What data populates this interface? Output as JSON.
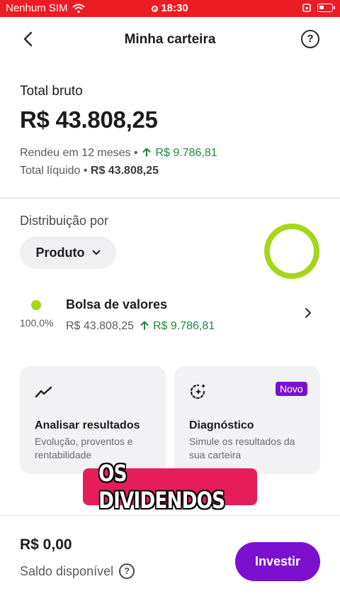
{
  "status_bar": {
    "carrier": "Nenhum SIM",
    "time": "18:30"
  },
  "header": {
    "title": "Minha carteira",
    "help": "?"
  },
  "summary": {
    "total_label": "Total bruto",
    "total_value": "R$ 43.808,25",
    "earned_label": "Rendeu em 12 meses",
    "earned_value": "R$ 9.786,81",
    "net_label": "Total líquido",
    "net_value": "R$ 43.808,25",
    "separator": "•"
  },
  "distribution": {
    "label": "Distribuição por",
    "filter": "Produto",
    "chart_color": "#a6d61a",
    "assets": [
      {
        "name": "Bolsa de valores",
        "percent": "100,0%",
        "value": "R$ 43.808,25",
        "gain": "R$ 9.786,81"
      }
    ]
  },
  "cards": [
    {
      "title": "Analisar resultados",
      "subtitle": "Evolução, proventos e rentabilidade",
      "icon": "trend-line-icon"
    },
    {
      "title": "Diagnóstico",
      "subtitle": "Simule os resultados da sua carteira",
      "icon": "sparkle-circle-icon",
      "badge": "Novo"
    }
  ],
  "caption": "OS DIVIDENDOS",
  "footer": {
    "balance": "R$ 0,00",
    "balance_label": "Saldo disponível",
    "help": "?",
    "invest_button": "Investir"
  },
  "colors": {
    "status_bar": "#ec1c24",
    "primary": "#7b11cf",
    "gain": "#1f8a3b",
    "caption": "#e51e5b"
  }
}
